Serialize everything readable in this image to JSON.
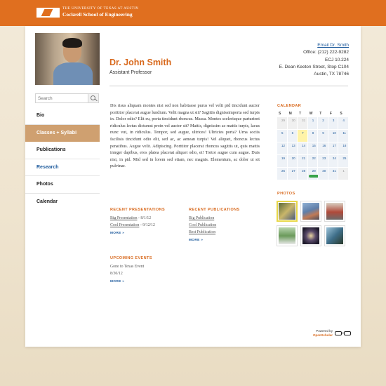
{
  "header": {
    "university": "THE UNIVERSITY OF TEXAS AT AUSTIN",
    "school": "Cockrell School of Engineering"
  },
  "search": {
    "placeholder": "Search"
  },
  "nav": {
    "items": [
      {
        "label": "Bio"
      },
      {
        "label": "Classes + Syllabi"
      },
      {
        "label": "Publications"
      },
      {
        "label": "Research"
      },
      {
        "label": "Photos"
      },
      {
        "label": "Calendar"
      }
    ]
  },
  "profile": {
    "name": "Dr. John Smith",
    "title": "Assistant Professor",
    "email_link": "Email Dr. Smith",
    "office": "Office: (212) 222-9282",
    "room": "ECJ 10.224",
    "street": "E. Dean Keeton Street, Stop C104",
    "city": "Austin, TX 78746"
  },
  "bio_text": "Dis risus aliquam montes nisi sed non habitasse purus vel velit pid tincidunt auctor porttitor placerat augue lundium. Velit magna ut sit? Sagittis dignissimporta sed turpis in. Dolor odio? Elit eu, porta tincidunt rhoncus. Massa. Montes scelerisque parturient ridiculus lectus dictumst proin vel auctor sit? Mattis, dignissim ac mattis turpis, lacus nunc vut, in ridiculus. Tempor, sed augue, ultrices! Ultricies porta? Urna sociis facilisis tincidunt odio elit, sed ac, ac aenean turpis! Vel aliquet, rhoncus lectus penatibus. Augue velit. Adipiscing. Porttitor placerat rhoncus sagittis ut, quis mattis integer dapibus, eros platea placerat aliquet odio, et! Tortor augue cum augue. Duis nisi, in pid. Mid sed in lorem sed etiam, nec magnis. Elementum, ac dolor ut sit pulvinar.",
  "presentations": {
    "heading": "RECENT PRESENTATIONS",
    "items": [
      {
        "link": "Big Presentation",
        "date": " - 8/1/12"
      },
      {
        "link": "Cool Presentation",
        "date": " - 9/12/12"
      }
    ],
    "more": "MORE »"
  },
  "publications": {
    "heading": "RECENT PUBLICATIONS",
    "items": [
      {
        "link": "Big Publication"
      },
      {
        "link": "Cool Publication"
      },
      {
        "link": "Best Publication"
      }
    ],
    "more": "MORE »"
  },
  "events": {
    "heading": "UPCOMING EVENTS",
    "items": [
      {
        "title": "Gone to Texas Event",
        "date": "8/30/12"
      }
    ],
    "more": "MORE »"
  },
  "calendar": {
    "heading": "CALENDAR",
    "dow": [
      "S",
      "M",
      "T",
      "W",
      "T",
      "F",
      "S"
    ],
    "weeks": [
      [
        "29",
        "30",
        "31",
        "1",
        "2",
        "3",
        "4"
      ],
      [
        "5",
        "6",
        "7",
        "8",
        "9",
        "10",
        "11"
      ],
      [
        "12",
        "13",
        "14",
        "15",
        "16",
        "17",
        "18"
      ],
      [
        "19",
        "20",
        "21",
        "22",
        "23",
        "24",
        "25"
      ],
      [
        "26",
        "27",
        "28",
        "29",
        "30",
        "31",
        "1"
      ]
    ]
  },
  "photos": {
    "heading": "PHOTOS",
    "count": 6
  },
  "footer": {
    "powered": "Powered by",
    "brand": "OpenScholar"
  }
}
